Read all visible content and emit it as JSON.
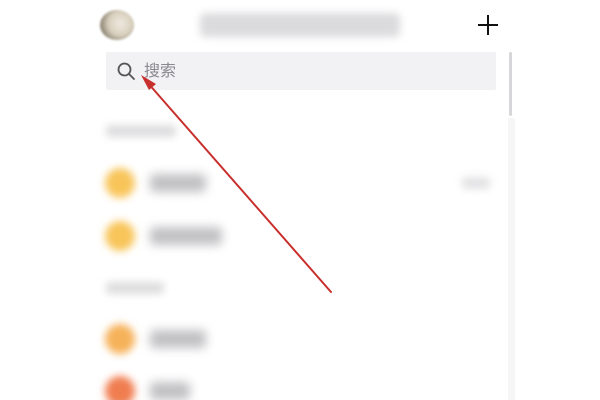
{
  "header": {
    "account_text": "",
    "add_icon": "plus-icon"
  },
  "search": {
    "icon": "search-icon",
    "placeholder": "搜索"
  },
  "list": {
    "sections": [
      {
        "header": "",
        "items": [
          {
            "label": "",
            "icon_color": "#f8c55a",
            "meta": ""
          },
          {
            "label": "",
            "icon_color": "#f8c55a"
          }
        ]
      },
      {
        "header": "",
        "items": [
          {
            "label": "",
            "icon_color": "#f6b25a"
          },
          {
            "label": "",
            "icon_color": "#f07d50"
          }
        ]
      }
    ]
  },
  "annotation": {
    "arrow_color": "#c8302e"
  }
}
